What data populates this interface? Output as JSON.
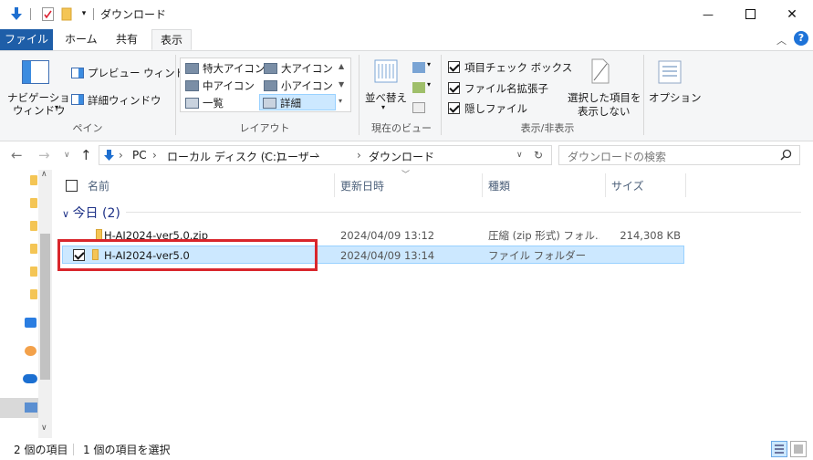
{
  "window": {
    "title": "ダウンロード",
    "minimize": "—",
    "maximize": "☐",
    "close": "✕"
  },
  "ribbon_tabs": {
    "file": "ファイル",
    "home": "ホーム",
    "share": "共有",
    "view": "表示"
  },
  "ribbon": {
    "pane_group": {
      "nav_pane_label_1": "ナビゲーション",
      "nav_pane_label_2": "ウィンドウ",
      "preview_pane": "プレビュー ウィンドウ",
      "details_pane": "詳細ウィンドウ",
      "group_label": "ペイン"
    },
    "layout_group": {
      "items": [
        {
          "label": "特大アイコン"
        },
        {
          "label": "大アイコン"
        },
        {
          "label": "中アイコン"
        },
        {
          "label": "小アイコン"
        },
        {
          "label": "一覧"
        },
        {
          "label": "詳細"
        }
      ],
      "selected": "詳細",
      "group_label": "レイアウト"
    },
    "current_view_group": {
      "sort_label": "並べ替え",
      "group_label": "現在のビュー"
    },
    "show_hide_group": {
      "item_checkboxes": "項目チェック ボックス",
      "file_extensions": "ファイル名拡張子",
      "hidden_files": "隠しファイル",
      "hide_selected_1": "選択した項目を",
      "hide_selected_2": "表示しない",
      "group_label": "表示/非表示"
    },
    "options": {
      "label": "オプション"
    }
  },
  "address_bar": {
    "crumbs": [
      "PC",
      "ローカル ディスク (C:)",
      "ユーザー",
      "",
      "ダウンロード"
    ],
    "search_placeholder": "ダウンロードの検索"
  },
  "columns": {
    "name": "名前",
    "modified": "更新日時",
    "type": "種類",
    "size": "サイズ"
  },
  "group": {
    "title": "今日 (2)"
  },
  "files": [
    {
      "name": "H-AI2024-ver5.0.zip",
      "modified": "2024/04/09 13:12",
      "type": "圧縮 (zip 形式) フォル...",
      "size": "214,308 KB",
      "selected": false
    },
    {
      "name": "H-AI2024-ver5.0",
      "modified": "2024/04/09 13:14",
      "type": "ファイル フォルダー",
      "size": "",
      "selected": true
    }
  ],
  "status": {
    "count": "2 個の項目",
    "selected": "1 個の項目を選択"
  },
  "colors": {
    "accent": "#1e5ea8",
    "selection": "#cce8ff",
    "highlight_box": "#d9262c",
    "folder": "#f4c555"
  }
}
